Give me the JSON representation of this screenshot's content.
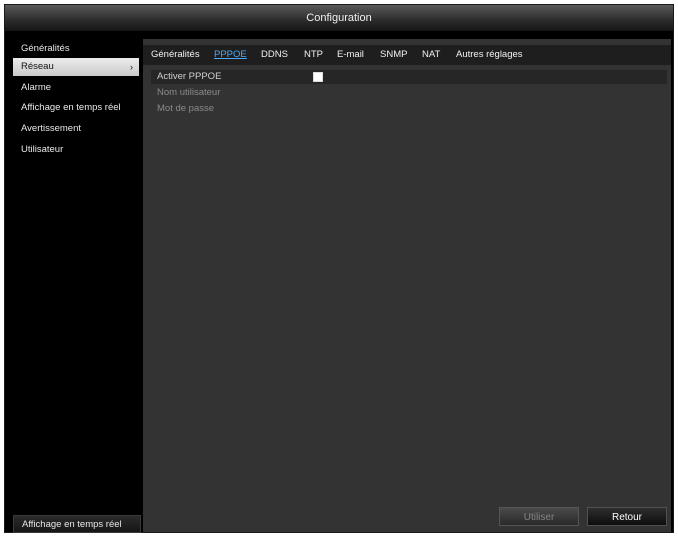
{
  "window": {
    "title": "Configuration"
  },
  "sidebar": {
    "items": [
      {
        "label": "Généralités"
      },
      {
        "label": "Réseau"
      },
      {
        "label": "Alarme"
      },
      {
        "label": "Affichage en temps réel"
      },
      {
        "label": "Avertissement"
      },
      {
        "label": "Utilisateur"
      }
    ],
    "active_index": 1,
    "bottom_button": "Affichage en temps réel"
  },
  "tabs": [
    {
      "label": "Généralités"
    },
    {
      "label": "PPPOE"
    },
    {
      "label": "DDNS"
    },
    {
      "label": "NTP"
    },
    {
      "label": "E-mail"
    },
    {
      "label": "SNMP"
    },
    {
      "label": "NAT"
    },
    {
      "label": "Autres réglages"
    }
  ],
  "active_tab_index": 1,
  "form": {
    "enable_pppoe": {
      "label": "Activer PPPOE",
      "checked": false
    },
    "username": {
      "label": "Nom utilisateur",
      "value": ""
    },
    "password": {
      "label": "Mot de passe",
      "value": ""
    }
  },
  "buttons": {
    "apply": "Utiliser",
    "back": "Retour"
  },
  "colors": {
    "active_tab": "#4aa8ff",
    "panel_bg": "#333333",
    "window_bg": "#000000"
  }
}
